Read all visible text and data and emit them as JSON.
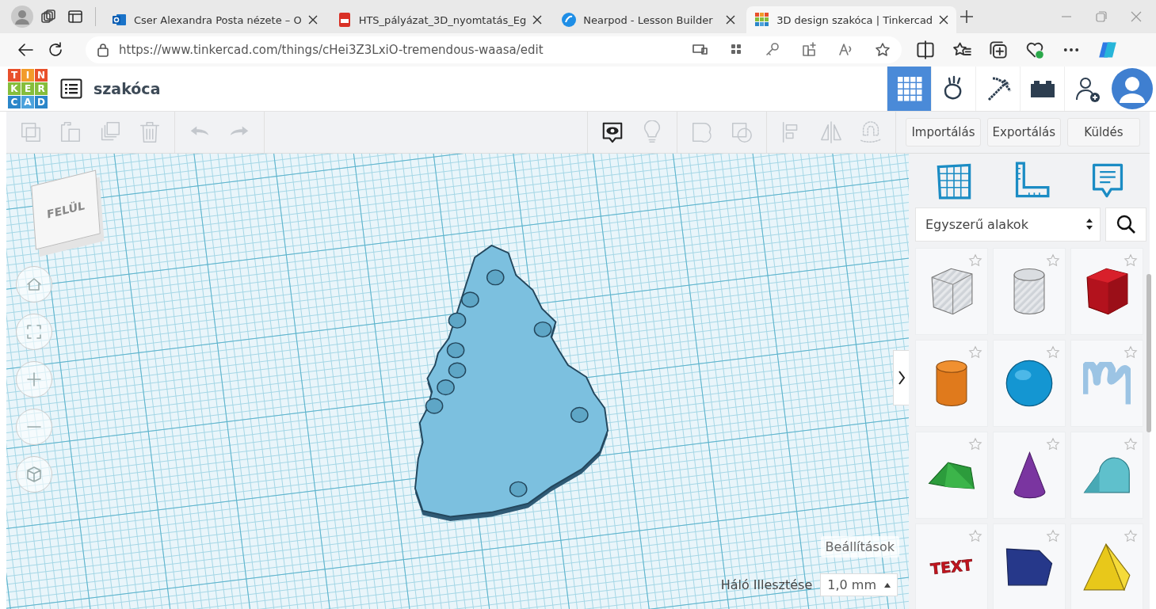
{
  "browser": {
    "tabs": [
      {
        "kind": "mail",
        "title": "Cser Alexandra Posta nézete – O",
        "selected": false
      },
      {
        "kind": "pdf",
        "title": "HTS_pályázat_3D_nyomtatás_Eg",
        "selected": false
      },
      {
        "kind": "nearpod",
        "title": "Nearpod - Lesson Builder",
        "selected": false
      },
      {
        "kind": "tinkercad",
        "title": "3D design szakóca | Tinkercad",
        "selected": true
      }
    ],
    "address": {
      "url": "https://www.tinkercad.com/things/cHei3Z3LxiO-tremendous-waasa/edit"
    }
  },
  "app": {
    "logo": [
      "T",
      "I",
      "N",
      "K",
      "E",
      "R",
      "C",
      "A",
      "D"
    ],
    "title": "szakóca",
    "nav": [
      {
        "kind": "grid",
        "selected": true
      },
      {
        "kind": "hand",
        "selected": false
      },
      {
        "kind": "pickaxe",
        "selected": false
      },
      {
        "kind": "brick",
        "selected": false
      },
      {
        "kind": "add-user",
        "selected": false
      }
    ]
  },
  "toolbar": [
    {
      "kind": "copy",
      "disabled": true
    },
    {
      "kind": "paste",
      "disabled": true
    },
    {
      "kind": "duplicate",
      "disabled": true
    },
    {
      "kind": "delete",
      "disabled": true
    },
    {
      "kind": "undo",
      "disabled": true
    },
    {
      "kind": "redo",
      "disabled": true
    },
    {
      "kind": "note",
      "disabled": false
    },
    {
      "kind": "bulb",
      "disabled": true
    },
    {
      "kind": "group",
      "disabled": true
    },
    {
      "kind": "ungroup",
      "disabled": true
    },
    {
      "kind": "align",
      "disabled": true
    },
    {
      "kind": "mirror",
      "disabled": true
    },
    {
      "kind": "magnet",
      "disabled": true
    }
  ],
  "actions": [
    "Importálás",
    "Exportálás",
    "Küldés"
  ],
  "panel": {
    "tools": [
      {
        "kind": "grid"
      },
      {
        "kind": "ruler"
      },
      {
        "kind": "note"
      }
    ],
    "library": {
      "value": "Egyszerű alakok"
    },
    "shapes": [
      {
        "kind": "box-hole",
        "favorite": false
      },
      {
        "kind": "cylinder-hole",
        "favorite": false
      },
      {
        "kind": "box",
        "favorite": false
      },
      {
        "kind": "cylinder",
        "favorite": false
      },
      {
        "kind": "sphere",
        "favorite": false
      },
      {
        "kind": "scribble",
        "favorite": false
      },
      {
        "kind": "roof",
        "favorite": false
      },
      {
        "kind": "cone",
        "favorite": false
      },
      {
        "kind": "round-roof",
        "favorite": false
      },
      {
        "kind": "text",
        "favorite": false,
        "label": "TEXT"
      },
      {
        "kind": "polygon",
        "favorite": false
      },
      {
        "kind": "pyramid",
        "favorite": false
      }
    ]
  },
  "viewport": {
    "view_cube": "FELÜL",
    "settings": "Beállítások",
    "snap_label": "Háló Illesztése",
    "snap_value": "1,0 mm"
  }
}
